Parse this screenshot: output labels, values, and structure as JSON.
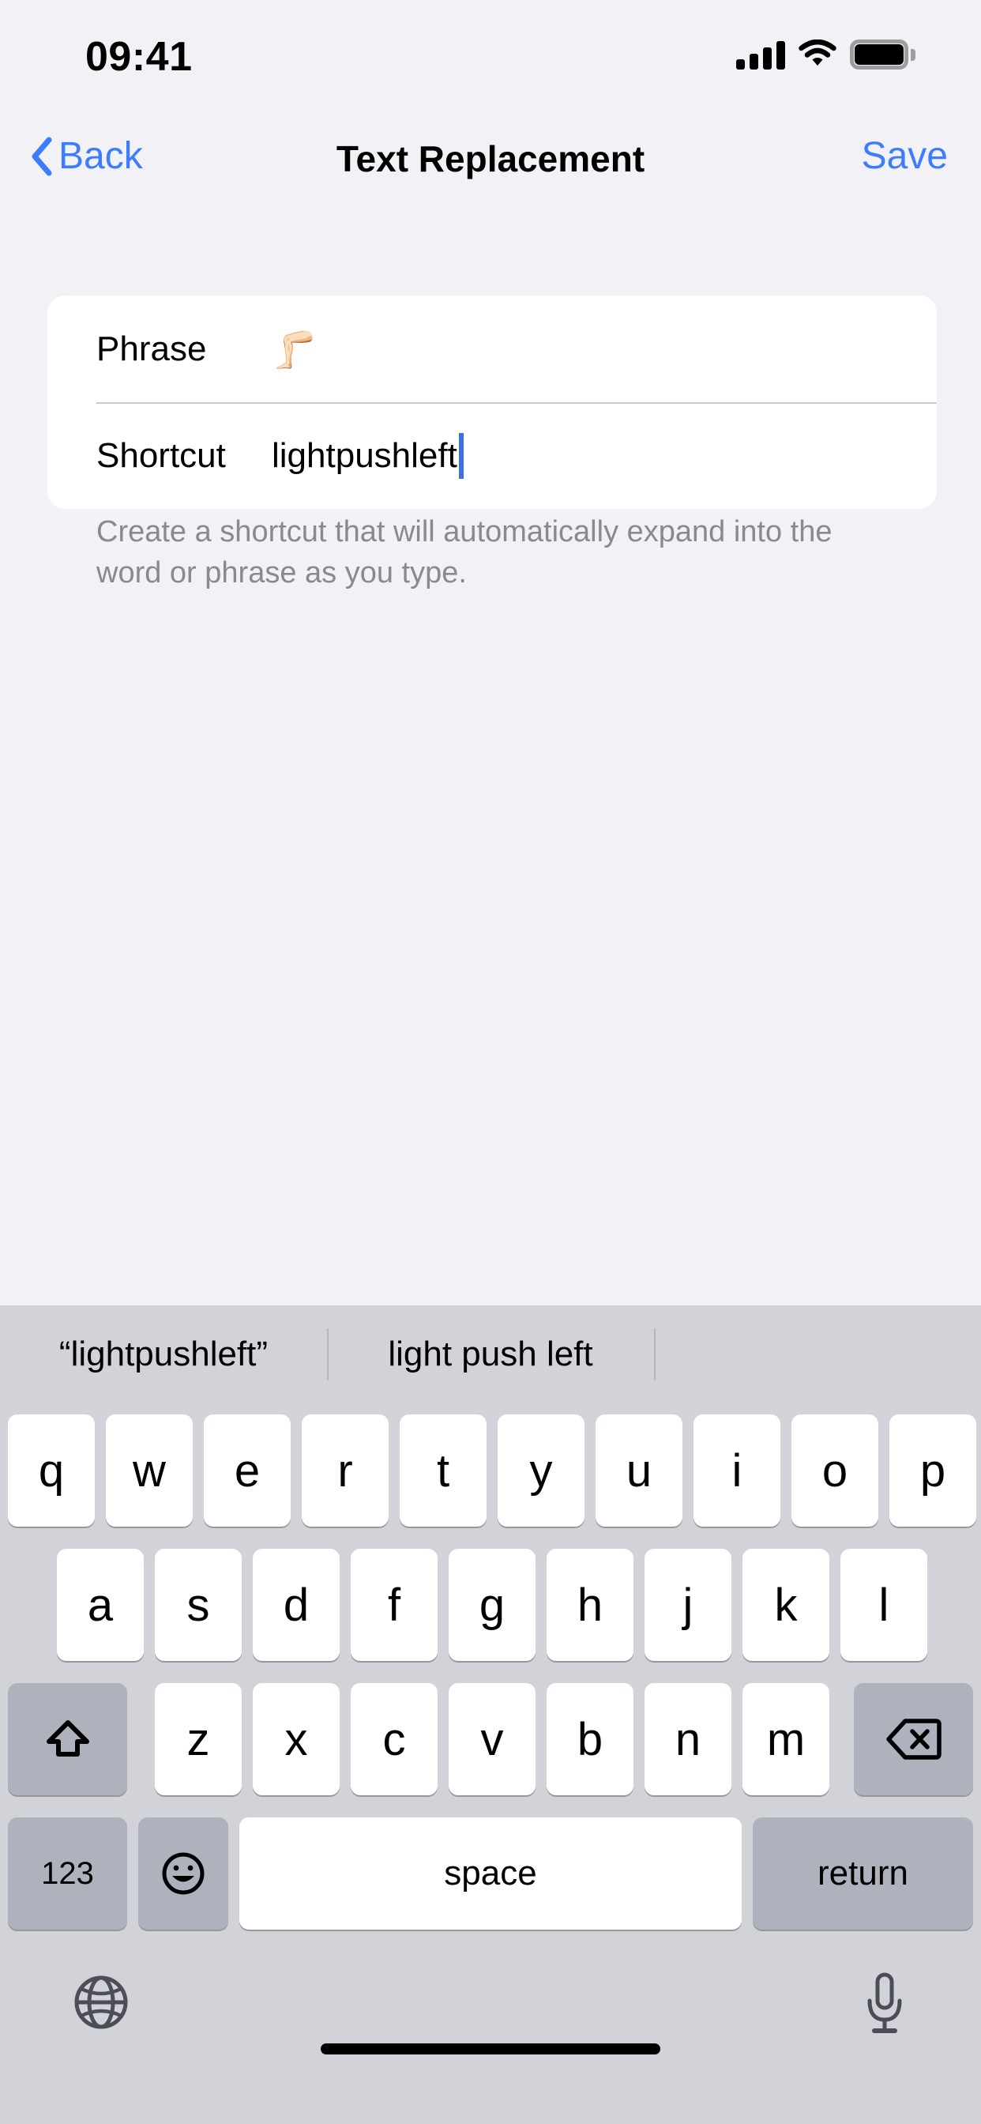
{
  "status_bar": {
    "time": "09:41",
    "signal_icon": "cellular-signal-icon",
    "wifi_icon": "wifi-icon",
    "battery_icon": "battery-full-icon"
  },
  "nav_bar": {
    "back_label": "Back",
    "title": "Text Replacement",
    "save_label": "Save",
    "tint_color": "#3c7dfd"
  },
  "form": {
    "rows": [
      {
        "label": "Phrase",
        "value": "🦵🏻",
        "placeholder": "Phrase",
        "is_emoji": true,
        "focused": false
      },
      {
        "label": "Shortcut",
        "value": "lightpushleft",
        "placeholder": "Shortcut",
        "is_emoji": false,
        "focused": true
      }
    ],
    "footnote": "Create a shortcut that will automatically expand into the word or phrase as you type."
  },
  "keyboard": {
    "predictions": [
      "“lightpushleft”",
      "light push left",
      ""
    ],
    "row1": [
      "q",
      "w",
      "e",
      "r",
      "t",
      "y",
      "u",
      "i",
      "o",
      "p"
    ],
    "row2": [
      "a",
      "s",
      "d",
      "f",
      "g",
      "h",
      "j",
      "k",
      "l"
    ],
    "row3": [
      "z",
      "x",
      "c",
      "v",
      "b",
      "n",
      "m"
    ],
    "shift_icon": "shift-arrow-icon",
    "backspace_icon": "backspace-delete-icon",
    "numbers_label": "123",
    "emoji_icon": "emoji-smiley-icon",
    "space_label": "space",
    "return_label": "return",
    "globe_icon": "globe-language-icon",
    "mic_icon": "microphone-dictation-icon",
    "key_bg": "#ffffff",
    "modifier_key_bg": "#adb2bc",
    "keyboard_bg": "#d1d3d9"
  }
}
